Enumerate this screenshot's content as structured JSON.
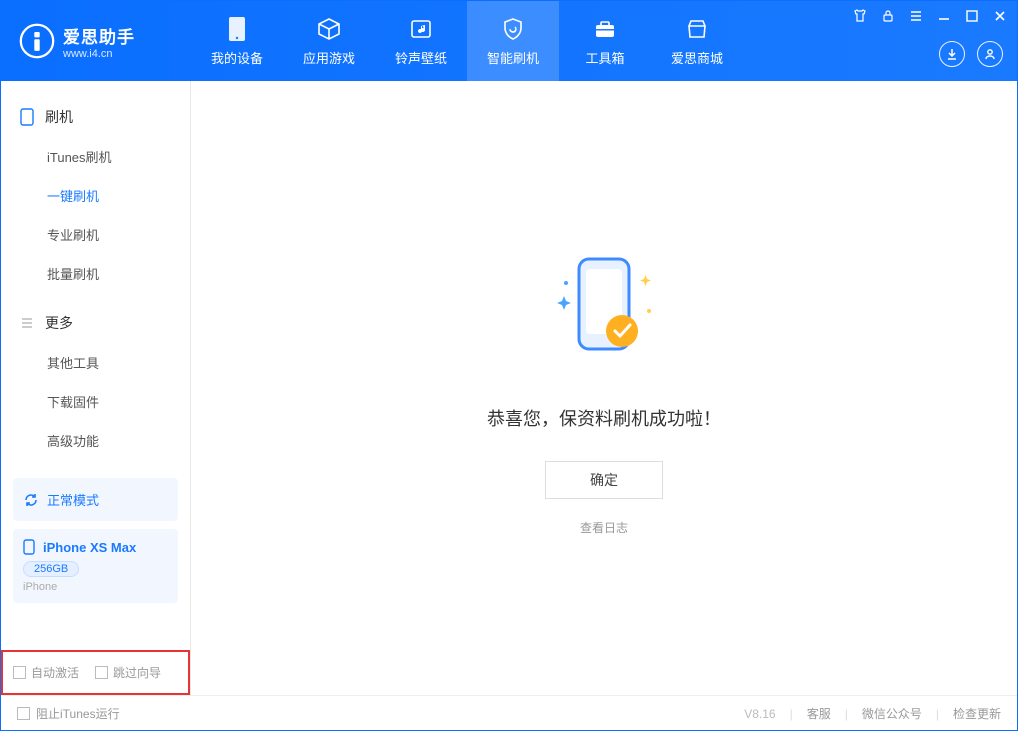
{
  "header": {
    "app_name": "爱思助手",
    "app_url": "www.i4.cn",
    "tabs": [
      {
        "label": "我的设备"
      },
      {
        "label": "应用游戏"
      },
      {
        "label": "铃声壁纸"
      },
      {
        "label": "智能刷机"
      },
      {
        "label": "工具箱"
      },
      {
        "label": "爱思商城"
      }
    ]
  },
  "sidebar": {
    "section1_title": "刷机",
    "items1": [
      {
        "label": "iTunes刷机"
      },
      {
        "label": "一键刷机"
      },
      {
        "label": "专业刷机"
      },
      {
        "label": "批量刷机"
      }
    ],
    "section2_title": "更多",
    "items2": [
      {
        "label": "其他工具"
      },
      {
        "label": "下载固件"
      },
      {
        "label": "高级功能"
      }
    ],
    "mode_label": "正常模式",
    "device_name": "iPhone XS Max",
    "device_storage": "256GB",
    "device_type": "iPhone",
    "checkbox1": "自动激活",
    "checkbox2": "跳过向导"
  },
  "main": {
    "success_msg": "恭喜您，保资料刷机成功啦！",
    "ok_button": "确定",
    "view_log": "查看日志"
  },
  "footer": {
    "block_itunes": "阻止iTunes运行",
    "version": "V8.16",
    "link1": "客服",
    "link2": "微信公众号",
    "link3": "检查更新"
  }
}
